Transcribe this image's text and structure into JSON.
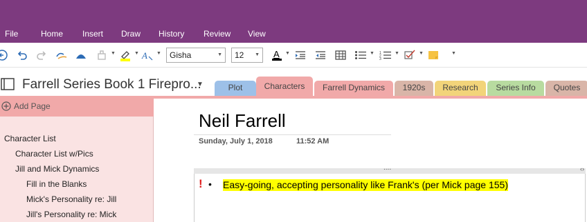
{
  "menu": [
    "File",
    "Home",
    "Insert",
    "Draw",
    "History",
    "Review",
    "View"
  ],
  "toolbar": {
    "font_name": "Gisha",
    "font_size": "12",
    "icons": [
      "back-icon",
      "undo-icon",
      "redo-icon",
      "sync-icon",
      "network-icon",
      "format-painter-icon",
      "highlight-icon",
      "font-color-icon",
      "clear-format-icon",
      "indent-icon",
      "outdent-icon",
      "table-icon",
      "bullets-icon",
      "numbering-icon",
      "tag-icon",
      "sticky-note-icon",
      "more-icon"
    ]
  },
  "notebook": {
    "title": "Farrell Series Book 1 Firepro...",
    "tabs": [
      {
        "label": "Plot",
        "color": "#9dc0e8"
      },
      {
        "label": "Characters",
        "color": "#f1a9a9",
        "active": true
      },
      {
        "label": "Farrell Dynamics",
        "color": "#f1a9a9"
      },
      {
        "label": "1920s",
        "color": "#d9b5a8"
      },
      {
        "label": "Research",
        "color": "#f2d47a"
      },
      {
        "label": "Series Info",
        "color": "#b8dba0"
      },
      {
        "label": "Quotes",
        "color": "#d9b5a8"
      }
    ]
  },
  "sidebar": {
    "add_page": "Add Page",
    "pages": [
      {
        "label": "Character List",
        "level": 0
      },
      {
        "label": "Character List w/Pics",
        "level": 1
      },
      {
        "label": "Jill and Mick Dynamics",
        "level": 1
      },
      {
        "label": "Fill in the Blanks",
        "level": 2
      },
      {
        "label": "Mick's Personality re: Jill",
        "level": 2
      },
      {
        "label": "Jill's Personality re: Mick",
        "level": 2
      }
    ]
  },
  "page": {
    "title": "Neil Farrell",
    "date": "Sunday, July 1, 2018",
    "time": "11:52 AM",
    "important_mark": "!",
    "bullet": "•",
    "note": "Easy-going, accepting personality like Frank's (per Mick page 155)",
    "outline_handle": "....",
    "outline_resize": "‹›"
  },
  "colors": {
    "brand": "#7d3a7f",
    "section_active": "#f1a9a9",
    "highlight": "#ffff00"
  }
}
